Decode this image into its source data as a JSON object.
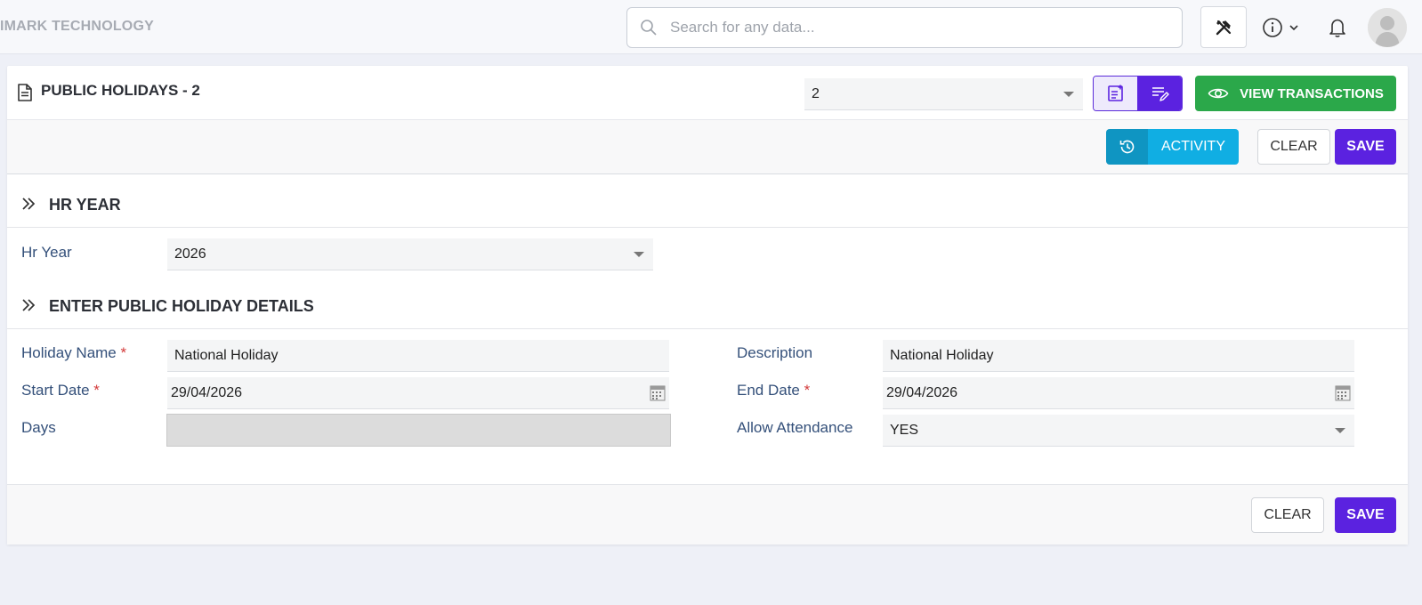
{
  "header": {
    "brand": "IMARK TECHNOLOGY",
    "search_placeholder": "Search for any data..."
  },
  "page": {
    "title": "PUBLIC HOLIDAYS - 2",
    "record_select_value": "2",
    "view_transactions_label": "VIEW TRANSACTIONS",
    "activity_label": "ACTIVITY",
    "clear_label": "CLEAR",
    "save_label": "SAVE"
  },
  "sections": {
    "hr_year": {
      "title": "HR YEAR",
      "hr_year_label": "Hr Year",
      "hr_year_value": "2026"
    },
    "details": {
      "title": "ENTER PUBLIC HOLIDAY DETAILS",
      "holiday_name_label": "Holiday Name",
      "holiday_name_value": "National Holiday",
      "description_label": "Description",
      "description_value": "National Holiday",
      "start_date_label": "Start Date",
      "start_date_value": "29/04/2026",
      "end_date_label": "End Date",
      "end_date_value": "29/04/2026",
      "days_label": "Days",
      "days_value": "",
      "allow_attendance_label": "Allow Attendance",
      "allow_attendance_value": "YES",
      "required_mark": "*"
    }
  },
  "footer": {
    "clear_label": "CLEAR",
    "save_label": "SAVE"
  },
  "colors": {
    "primary": "#5b22e0",
    "success": "#2ba84a",
    "info": "#10aee3",
    "label": "#34507a"
  }
}
